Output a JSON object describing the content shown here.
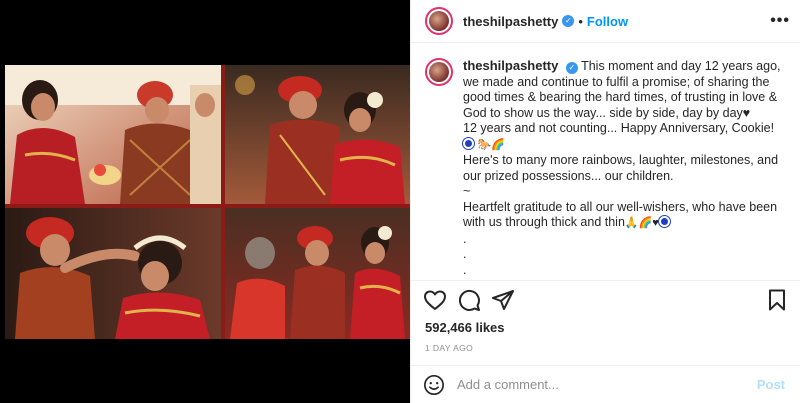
{
  "post": {
    "username": "theshilpashetty",
    "follow_label": "Follow",
    "more_label": "•••",
    "separator": "•",
    "verified_mark": "✓"
  },
  "caption": {
    "username": "theshilpashetty",
    "line1": "This moment and day 12 years ago, we made and continue to fulfil a promise; of sharing the good times & bearing the hard times, of trusting in love & God to show us the way... side by side, day by day♥",
    "line2": "12 years and not counting... Happy Anniversary, Cookie! ",
    "line2_emoji": "🐎🌈",
    "line3": "Here's to many more rainbows, laughter, milestones, and our prized possessions... our children.",
    "tilde": "~",
    "line4": "Heartfelt gratitude to all our well-wishers, who have been with us through thick and thin",
    "line4_emoji": "🙏🌈♥",
    "dots": [
      ".",
      ".",
      ".",
      ".",
      "."
    ]
  },
  "icons": {
    "like": "heart-icon",
    "comment": "comment-icon",
    "share": "share-icon",
    "save": "bookmark-icon",
    "emoji": "smiley-icon"
  },
  "likes_text": "592,466 likes",
  "time_ago": "1 DAY AGO",
  "comment_box": {
    "placeholder": "Add a comment...",
    "post_label": "Post"
  },
  "colors": {
    "follow": "#0095f6",
    "verified": "#3897f0",
    "post_disabled": "#b2dffc",
    "collage_frame": "#8a1b17"
  }
}
